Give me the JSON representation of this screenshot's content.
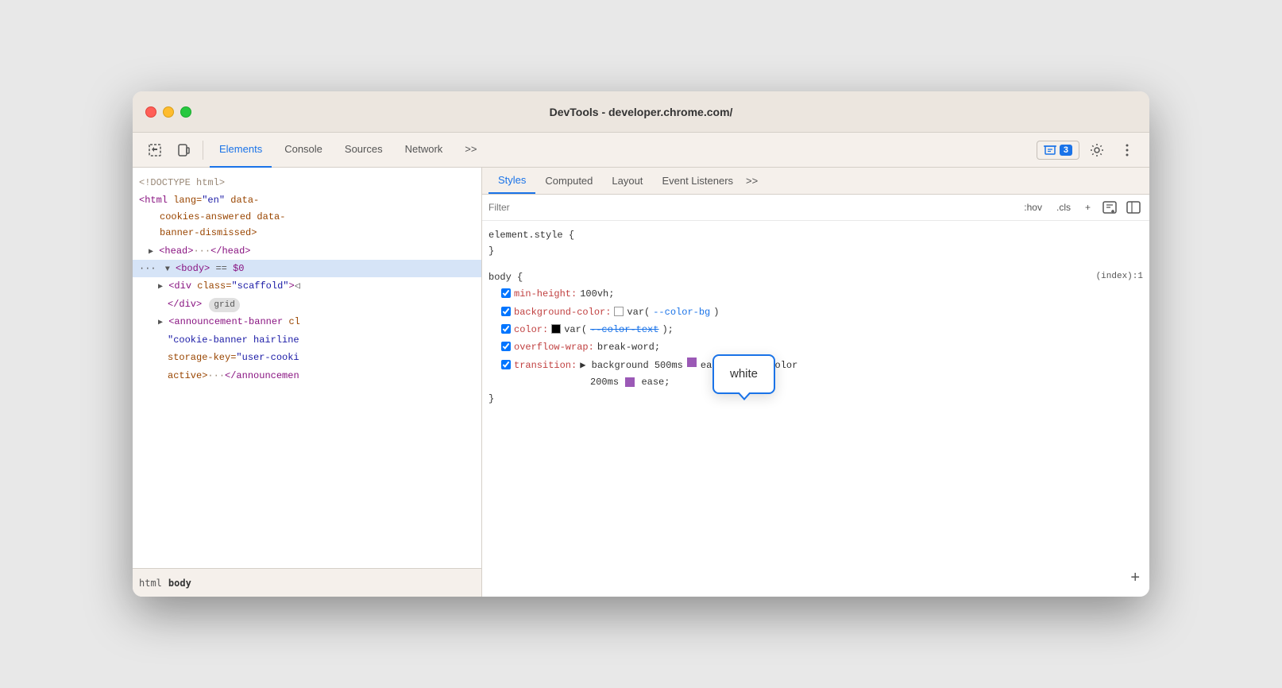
{
  "window": {
    "title": "DevTools - developer.chrome.com/"
  },
  "toolbar": {
    "tabs": [
      "Elements",
      "Console",
      "Sources",
      "Network"
    ],
    "more_label": ">>",
    "badge_label": "3",
    "settings_label": "⚙",
    "more_menu_label": "⋮"
  },
  "elements_panel": {
    "lines": [
      {
        "text": "<!DOCTYPE html>",
        "type": "comment",
        "indent": 0
      },
      {
        "text": "<html lang=\"en\" data-cookies-answered data-banner-dismissed>",
        "type": "html_open",
        "indent": 0
      },
      {
        "text": "▶ <head>···</head>",
        "type": "collapsed",
        "indent": 1
      },
      {
        "text": "··· ▼ <body> == $0",
        "type": "selected",
        "indent": 0
      },
      {
        "text": "▶ <div class=\"scaffold\">◁",
        "type": "html",
        "indent": 2
      },
      {
        "text": "</div>",
        "type": "html",
        "indent": 3
      },
      {
        "text": "▶ <announcement-banner cl",
        "type": "html",
        "indent": 2
      },
      {
        "text": "\"cookie-banner hairline",
        "type": "html",
        "indent": 3
      },
      {
        "text": "storage-key=\"user-cooki",
        "type": "html",
        "indent": 3
      },
      {
        "text": "active>···</announcemen",
        "type": "html",
        "indent": 3
      }
    ],
    "breadcrumb": [
      "html",
      "body"
    ]
  },
  "styles_panel": {
    "tabs": [
      "Styles",
      "Computed",
      "Layout",
      "Event Listeners",
      ">>"
    ],
    "filter_placeholder": "Filter",
    "filter_controls": [
      ":hov",
      ".cls",
      "+"
    ],
    "blocks": [
      {
        "selector": "element.style {",
        "close": "}",
        "properties": []
      },
      {
        "selector": "body {",
        "close": "}",
        "file_ref": "(index):1",
        "properties": [
          {
            "prop": "min-height:",
            "value": "100vh;",
            "checked": true
          },
          {
            "prop": "background-color:",
            "value_parts": [
              "var(",
              "--color-bg",
              ")"
            ],
            "has_swatch": true,
            "swatch_color": "white",
            "checked": true
          },
          {
            "prop": "color:",
            "value_parts": [
              "var(--color-text);"
            ],
            "has_swatch": true,
            "swatch_color": "black",
            "checked": true
          },
          {
            "prop": "overflow-wrap:",
            "value": "break-word;",
            "checked": true
          },
          {
            "prop": "transition:",
            "value_parts": [
              "▶ background 500ms",
              "ease-in-out,color",
              "200ms",
              "ease;"
            ],
            "has_ease": true,
            "checked": true
          }
        ]
      }
    ],
    "color_tooltip": {
      "text": "white"
    }
  },
  "icons": {
    "cursor_tool": "⊹",
    "device_toolbar": "⬜",
    "more_tabs": ">>",
    "add_style": "+",
    "new_style_rule": "🖹",
    "toggle_device": "⊡"
  }
}
